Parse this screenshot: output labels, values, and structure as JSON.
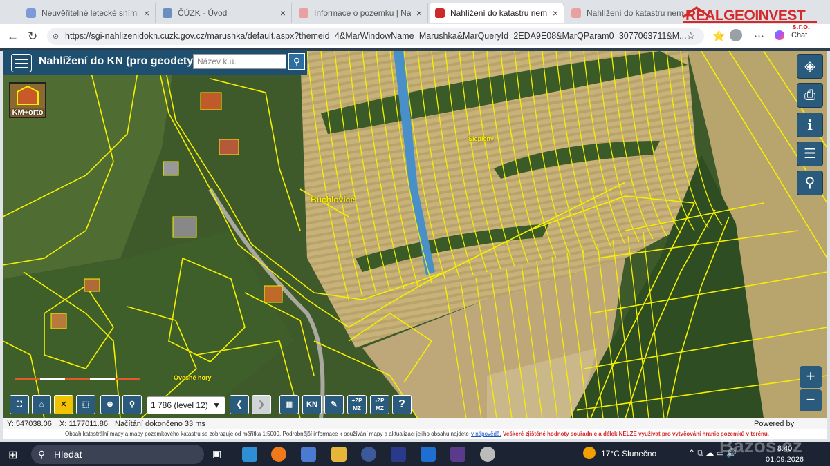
{
  "tabs": [
    {
      "title": "Neuvěřitelné letecké snímky sv",
      "active": false,
      "color": "#7d9ad8"
    },
    {
      "title": "ČÚZK - Úvod",
      "active": false,
      "color": "#6b8fbf"
    },
    {
      "title": "Informace o pozemku | Nahlíže",
      "active": false,
      "color": "#d9534f"
    },
    {
      "title": "Nahlížení do katastru nemovito",
      "active": true,
      "color": "#cc2b2b"
    },
    {
      "title": "Nahlížení do katastru nemovito",
      "active": false,
      "color": "#d9534f"
    }
  ],
  "browser": {
    "url": "https://sgi-nahlizenidokn.cuzk.gov.cz/marushka/default.aspx?themeid=4&MarWindowName=Marushka&MarQueryId=2EDA9E08&MarQParam0=3077063711&M...",
    "chat_label": "Chat"
  },
  "watermark": {
    "brand": "REALGEOINVEST",
    "suffix": "s.r.o."
  },
  "app": {
    "title": "Nahlížení do KN (pro geodety)",
    "search_placeholder": "Název k.ú.",
    "basemap_label": "KM+orto"
  },
  "map": {
    "labels": [
      "Buchlovice",
      "Slepičný",
      "Ovesné hory"
    ]
  },
  "toolbar": {
    "level": "1 786 (level 12)",
    "kn": "KN",
    "zp1": "+ZP MZ",
    "zp2": "-ZP MZ",
    "help": "?"
  },
  "status": {
    "y": "Y: 547038.06",
    "x": "X: 1177011.86",
    "load": "Načítání dokončeno 33 ms",
    "powered": "Powered by GEOVAP"
  },
  "note": {
    "text": "Obsah katastrální mapy a mapy pozemkového katastru se zobrazuje od měřítka 1:5000. Podrobnější informace k používání mapy a aktualizaci jejího obsahu najdete",
    "link": "v nápovědě.",
    "warning": "Veškeré zjištěné hodnoty souřadnic a délek NELZE využívat pro vytyčování hranic pozemků v terénu."
  },
  "taskbar": {
    "search": "Hledat",
    "weather": "17°C  Slunečno",
    "time": "8:40",
    "date": "01.09.2026",
    "watermark": "Bazoš.cz"
  }
}
